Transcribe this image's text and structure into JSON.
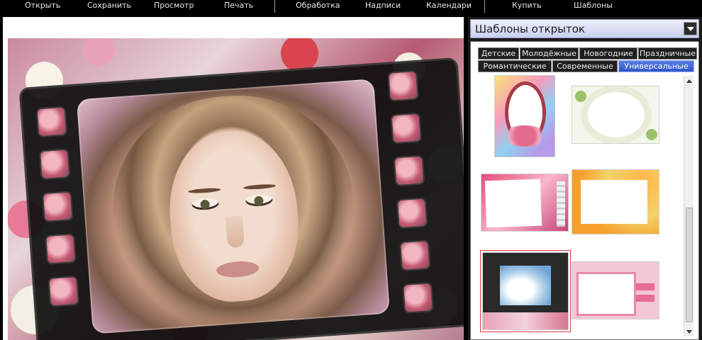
{
  "menu": {
    "items": [
      {
        "id": "open",
        "label": "Открыть"
      },
      {
        "id": "save",
        "label": "Сохранить"
      },
      {
        "id": "preview",
        "label": "Просмотр"
      },
      {
        "id": "print",
        "label": "Печать"
      },
      {
        "id": "process",
        "label": "Обработка"
      },
      {
        "id": "captions",
        "label": "Надписи"
      },
      {
        "id": "calendars",
        "label": "Календари"
      },
      {
        "id": "buy",
        "label": "Купить"
      },
      {
        "id": "templates",
        "label": "Шаблоны"
      }
    ]
  },
  "panel": {
    "title": "Шаблоны открыток",
    "tabs_row1": [
      "Детские",
      "Молодёжные",
      "Новогодние",
      "Праздничные"
    ],
    "tabs_row2": [
      "Романтические",
      "Современные",
      "Универсальные"
    ],
    "active_tab": "Универсальные",
    "selected_thumbnail": 5,
    "thumbnails": [
      {
        "icon": "rainbow-oval-frame-thumbnail"
      },
      {
        "icon": "floral-circle-frame-thumbnail"
      },
      {
        "icon": "pink-pearl-frame-thumbnail"
      },
      {
        "icon": "golden-floral-frame-thumbnail"
      },
      {
        "icon": "filmstrip-frame-thumbnail"
      },
      {
        "icon": "pink-tags-frame-thumbnail"
      }
    ]
  },
  "colors": {
    "menubar_bg": "#000000",
    "panel_header": "#c9cfee",
    "active_tab": "#2f55c9",
    "selection_outline": "#e03a3a"
  }
}
